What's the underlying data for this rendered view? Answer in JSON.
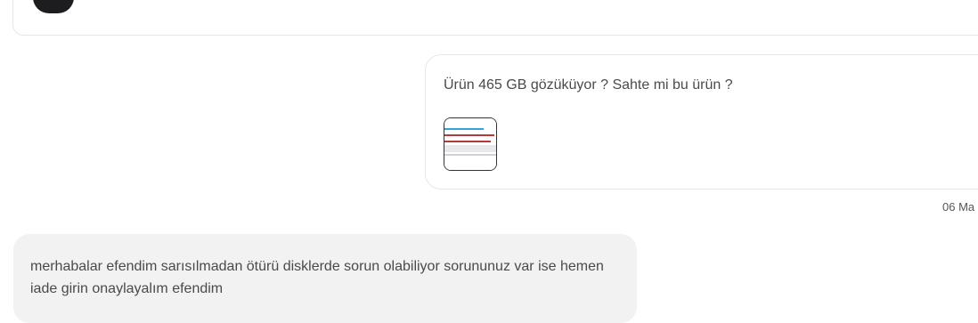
{
  "conversation": {
    "top_card": {
      "product_text": "",
      "thumb_icon": "product-image"
    },
    "messages": [
      {
        "direction": "outgoing",
        "text": "Ürün 465 GB gözüküyor ? Sahte mi bu ürün ?",
        "attachment_icon": "screenshot-thumbnail",
        "timestamp": "06 Ma"
      },
      {
        "direction": "incoming",
        "text": "merhabalar efendim sarısılmadan ötürü disklerde sorun olabiliyor sorununuz var ise hemen iade girin onaylayalım efendim"
      }
    ]
  },
  "colors": {
    "outgoing_bubble_border": "#e7e7e7",
    "incoming_bubble_bg": "#f2f2f2",
    "text": "#4a4a4a"
  }
}
